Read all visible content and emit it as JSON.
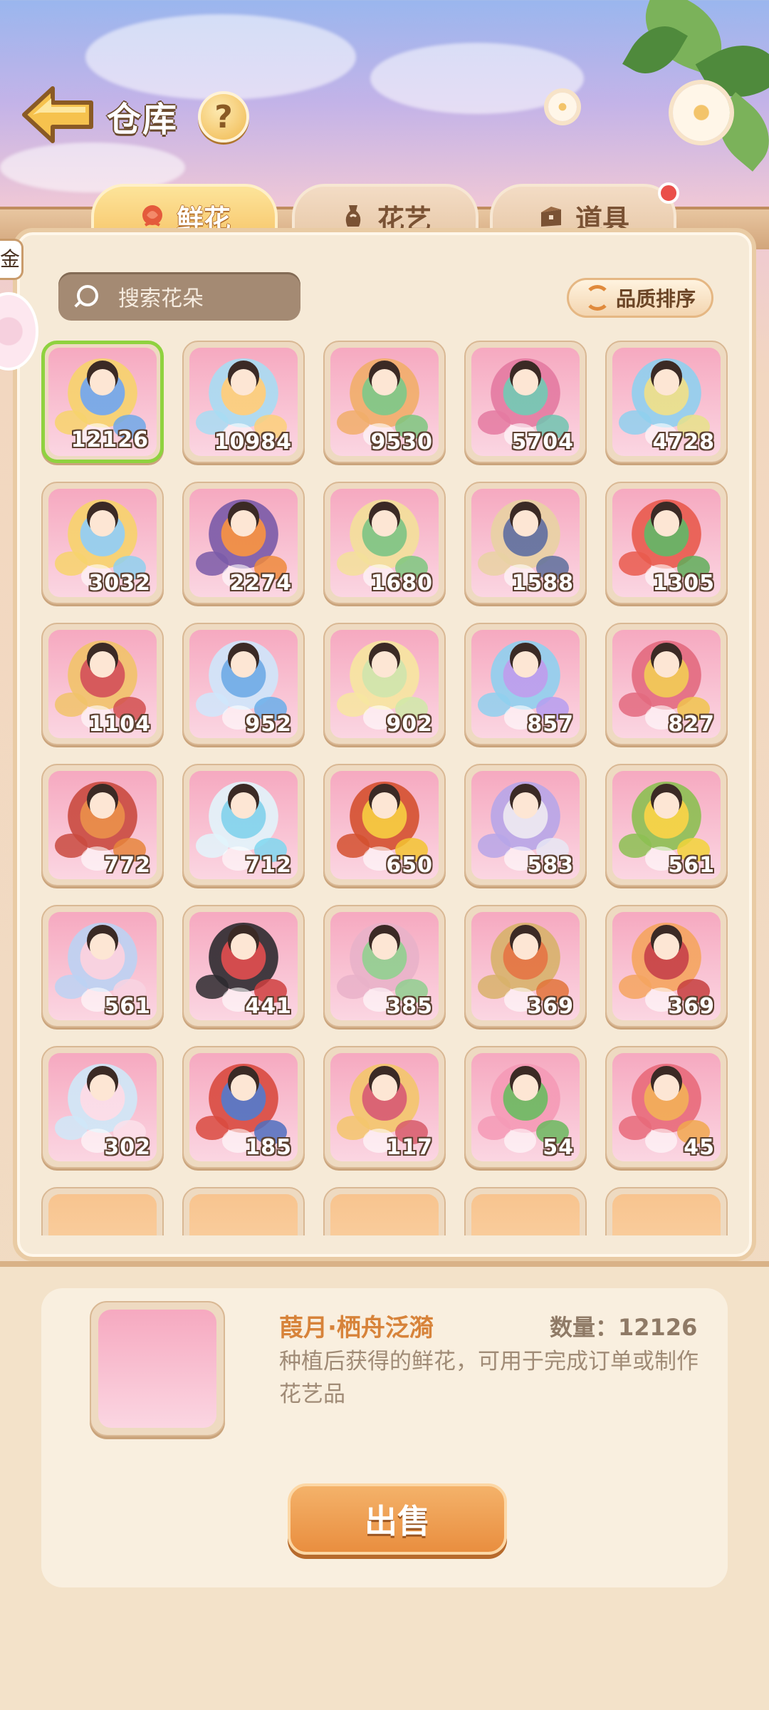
{
  "header": {
    "title": "仓库",
    "help_label": "?"
  },
  "tabs": [
    {
      "label": "鲜花",
      "icon": "rose-icon",
      "active": true
    },
    {
      "label": "花艺",
      "icon": "vase-icon",
      "active": false
    },
    {
      "label": "道具",
      "icon": "chest-icon",
      "active": false,
      "badge": true
    }
  ],
  "side_banner": {
    "text": "金!"
  },
  "search": {
    "placeholder": "搜索花朵"
  },
  "sort": {
    "label": "品质排序"
  },
  "items": [
    {
      "count": "12126",
      "palette": [
        "#f6a9c0",
        "#6fa8e8",
        "#f7d36c"
      ],
      "selected": true
    },
    {
      "count": "10984",
      "palette": [
        "#f6a9c0",
        "#fbd07a",
        "#a8dcf3"
      ]
    },
    {
      "count": "9530",
      "palette": [
        "#f6a9c0",
        "#7cc77f",
        "#f1ae6a"
      ]
    },
    {
      "count": "5704",
      "palette": [
        "#f6a9c0",
        "#6fc4b0",
        "#e47aa1"
      ]
    },
    {
      "count": "4728",
      "palette": [
        "#f6a9c0",
        "#e7e28a",
        "#8fd0ef"
      ]
    },
    {
      "count": "3032",
      "palette": [
        "#f6a9c0",
        "#8fd0ef",
        "#f7d36c"
      ]
    },
    {
      "count": "2274",
      "palette": [
        "#f6a9c0",
        "#ee8a3c",
        "#7a5aa8"
      ]
    },
    {
      "count": "1680",
      "palette": [
        "#f6a9c0",
        "#7cc77f",
        "#f3e09a"
      ]
    },
    {
      "count": "1588",
      "palette": [
        "#f6a9c0",
        "#5d6f9c",
        "#e9d2a3"
      ]
    },
    {
      "count": "1305",
      "palette": [
        "#f6a9c0",
        "#5fae5a",
        "#e95a4d"
      ]
    },
    {
      "count": "1104",
      "palette": [
        "#f6a9c0",
        "#d24f4f",
        "#f1c36a"
      ]
    },
    {
      "count": "952",
      "palette": [
        "#f6a9c0",
        "#6aaeea",
        "#cfe6fb"
      ]
    },
    {
      "count": "902",
      "palette": [
        "#f6a9c0",
        "#cfe9a8",
        "#f7e6a0"
      ]
    },
    {
      "count": "857",
      "palette": [
        "#f6a9c0",
        "#b69ef0",
        "#8fd0ef"
      ]
    },
    {
      "count": "827",
      "palette": [
        "#f6a9c0",
        "#f0c44d",
        "#e36a7f"
      ]
    },
    {
      "count": "772",
      "palette": [
        "#f6a9c0",
        "#e6853c",
        "#c94a3f"
      ]
    },
    {
      "count": "712",
      "palette": [
        "#f6a9c0",
        "#7fd7f0",
        "#e2f4fb"
      ]
    },
    {
      "count": "650",
      "palette": [
        "#f6a9c0",
        "#f3c431",
        "#d4502f"
      ]
    },
    {
      "count": "583",
      "palette": [
        "#f6a9c0",
        "#e8e8f4",
        "#b7a6e8"
      ]
    },
    {
      "count": "561",
      "palette": [
        "#f6a9c0",
        "#f2d43a",
        "#8cbf52"
      ]
    },
    {
      "count": "561",
      "palette": [
        "#f6a9c0",
        "#f8d4e2",
        "#bcd2f3"
      ]
    },
    {
      "count": "441",
      "palette": [
        "#f6a9c0",
        "#cf3f3f",
        "#2d2a2f"
      ]
    },
    {
      "count": "385",
      "palette": [
        "#f6a9c0",
        "#8fcf8f",
        "#e9b2c9"
      ]
    },
    {
      "count": "369",
      "palette": [
        "#f6a9c0",
        "#e2733a",
        "#d8b26b"
      ]
    },
    {
      "count": "369",
      "palette": [
        "#f6a9c0",
        "#c63e3e",
        "#f5a55f"
      ]
    },
    {
      "count": "302",
      "palette": [
        "#f6a9c0",
        "#fbe0ea",
        "#cfe8f8"
      ]
    },
    {
      "count": "185",
      "palette": [
        "#f6a9c0",
        "#4f6fbf",
        "#d94a3f"
      ]
    },
    {
      "count": "117",
      "palette": [
        "#f6a9c0",
        "#d75a6a",
        "#f3c66c"
      ]
    },
    {
      "count": "54",
      "palette": [
        "#f6a9c0",
        "#6ab85e",
        "#f59ab6"
      ]
    },
    {
      "count": "45",
      "palette": [
        "#f6a9c0",
        "#f1a84f",
        "#e86a7a"
      ]
    }
  ],
  "partial_row_count": 5,
  "detail": {
    "name": "葭月·栖舟泛漪",
    "quantity_label": "数量：12126",
    "description": "种植后获得的鲜花，可用于完成订单或制作花艺品",
    "sell_label": "出售"
  },
  "colors": {
    "accent": "#e98e3f",
    "selected_border": "#8fd23f",
    "name_color": "#d7833a",
    "badge": "#ea4f4a"
  }
}
